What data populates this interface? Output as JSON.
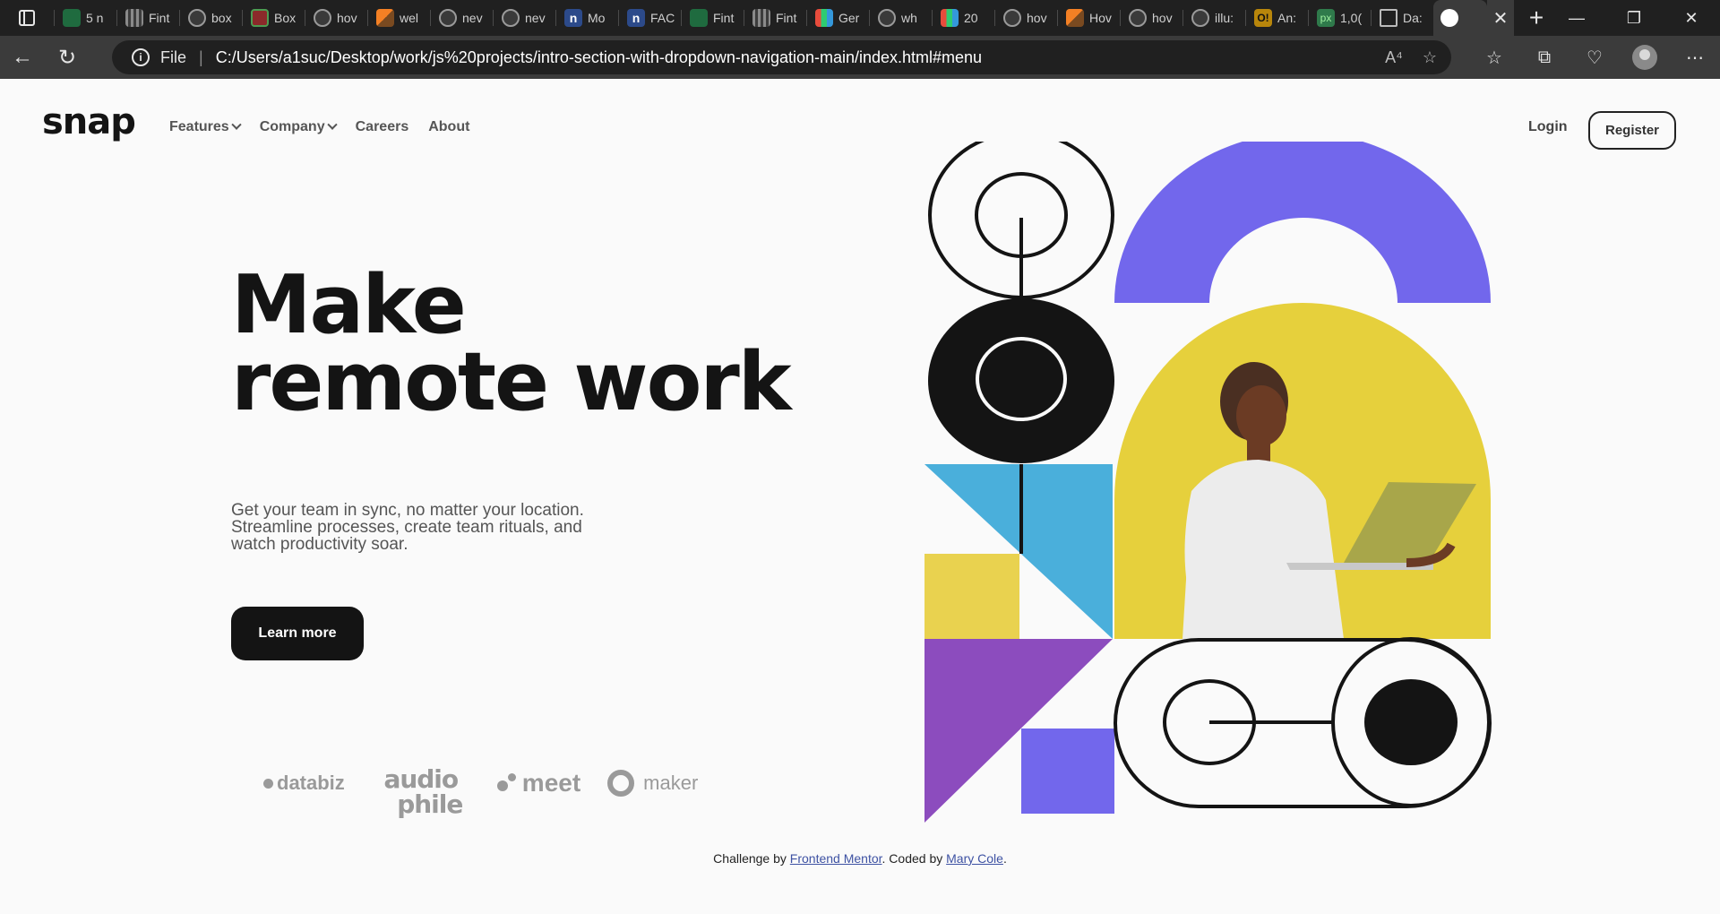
{
  "browser": {
    "tabs": [
      {
        "label": "5 n",
        "icon": "green"
      },
      {
        "label": "Fint",
        "icon": "grid"
      },
      {
        "label": "box",
        "icon": "find"
      },
      {
        "label": "Box",
        "icon": "red"
      },
      {
        "label": "hov",
        "icon": "find"
      },
      {
        "label": "wel",
        "icon": "stack"
      },
      {
        "label": "nev",
        "icon": "find"
      },
      {
        "label": "nev",
        "icon": "find"
      },
      {
        "label": "Mo",
        "icon": "n"
      },
      {
        "label": "FAC",
        "icon": "n"
      },
      {
        "label": "Fint",
        "icon": "green"
      },
      {
        "label": "Fint",
        "icon": "grid"
      },
      {
        "label": "Ger",
        "icon": "bars"
      },
      {
        "label": "wh",
        "icon": "find"
      },
      {
        "label": "20",
        "icon": "bars"
      },
      {
        "label": "hov",
        "icon": "find"
      },
      {
        "label": "Hov",
        "icon": "stack"
      },
      {
        "label": "hov",
        "icon": "find"
      },
      {
        "label": "illu:",
        "icon": "find"
      },
      {
        "label": "An:",
        "icon": "yellow"
      },
      {
        "label": "1,0(",
        "icon": "px"
      },
      {
        "label": "Da:",
        "icon": "doc"
      }
    ],
    "active_tab_close": "✕",
    "new_tab": "+",
    "window_controls": {
      "minimize": "—",
      "maximize": "❐",
      "close": "✕"
    },
    "back": "←",
    "reload": "↻",
    "address": {
      "info_icon": "i",
      "scheme_label": "File",
      "separator": "|",
      "url": "C:/Users/a1suc/Desktop/work/js%20projects/intro-section-with-dropdown-navigation-main/index.html#menu",
      "read_aloud": "A⁴",
      "favorite_add": "☆"
    },
    "toolbar": {
      "favorites": "☆",
      "collections": "⧉",
      "health": "♡",
      "menu": "⋯"
    }
  },
  "page": {
    "logo": "snap",
    "nav": [
      {
        "label": "Features",
        "dropdown": true
      },
      {
        "label": "Company",
        "dropdown": true
      },
      {
        "label": "Careers",
        "dropdown": false
      },
      {
        "label": "About",
        "dropdown": false
      }
    ],
    "login": "Login",
    "register": "Register",
    "hero": {
      "title_line1": "Make",
      "title_line2": "remote work",
      "text_line1": "Get your team in sync, no matter your location.",
      "text_line2": "Streamline processes, create team rituals, and",
      "text_line3": "watch productivity soar.",
      "cta": "Learn more"
    },
    "clients": {
      "databiz": "databiz",
      "audiophile_top": "audio",
      "audiophile_bottom": "phile",
      "meet": "meet",
      "maker": "maker"
    },
    "credit": {
      "prefix": "Challenge by ",
      "link1": "Frontend Mentor",
      "middle": ". Coded by ",
      "link2": "Mary Cole",
      "suffix": "."
    },
    "colors": {
      "purple_arch": "#7267ec",
      "yellow": "#e9d24f",
      "blue": "#4aafdb",
      "violet": "#8c4cbe",
      "dark": "#141414"
    }
  }
}
